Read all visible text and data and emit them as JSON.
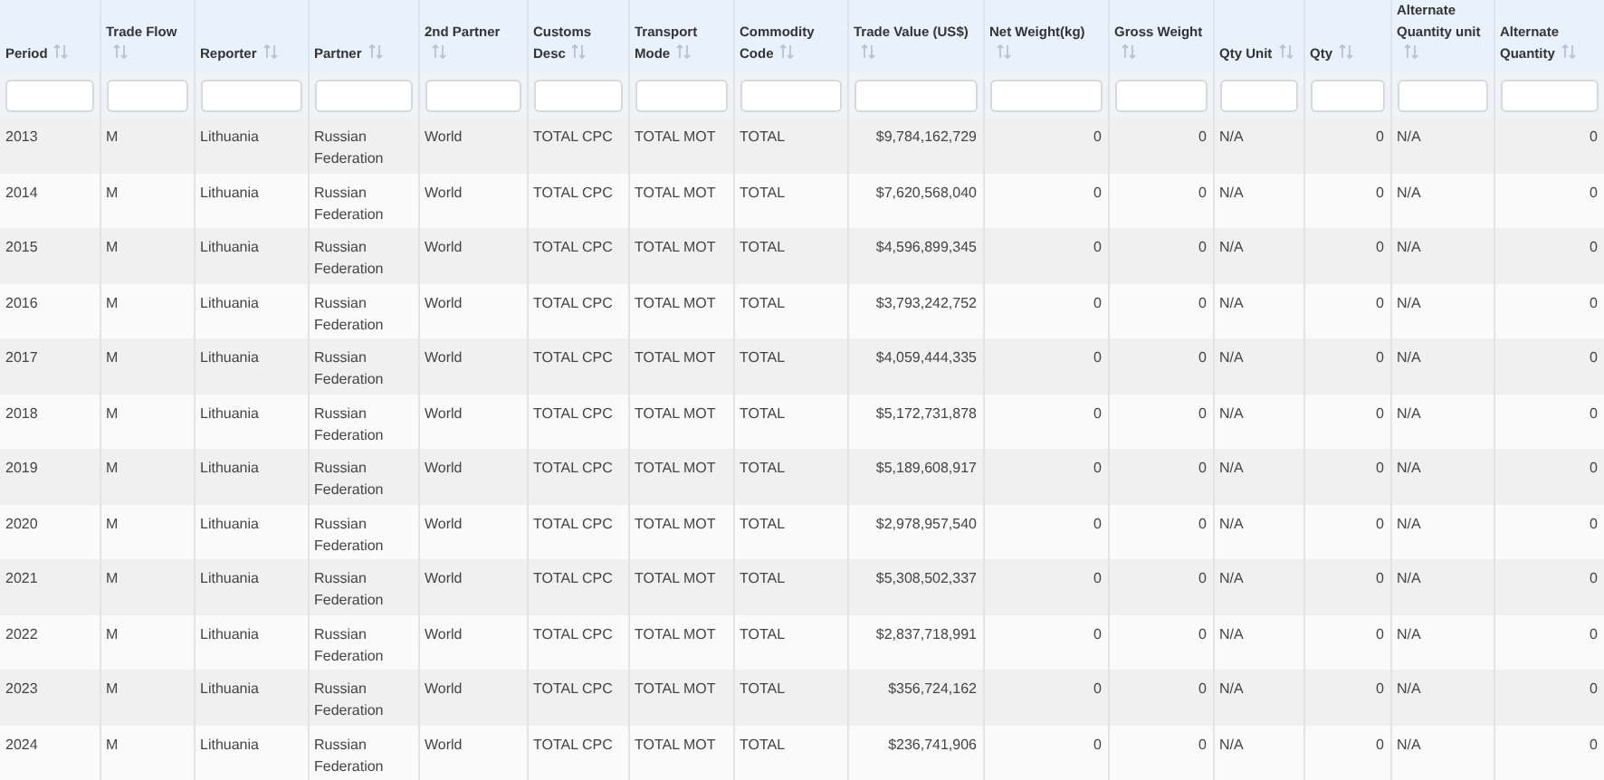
{
  "table": {
    "columns": [
      {
        "label": "Period",
        "kind": "text"
      },
      {
        "label": "Trade Flow",
        "kind": "text"
      },
      {
        "label": "Reporter",
        "kind": "text"
      },
      {
        "label": "Partner",
        "kind": "text"
      },
      {
        "label": "2nd Partner",
        "kind": "text"
      },
      {
        "label": "Customs Desc",
        "kind": "text"
      },
      {
        "label": "Transport Mode",
        "kind": "text"
      },
      {
        "label": "Commodity Code",
        "kind": "text"
      },
      {
        "label": "Trade Value (US$)",
        "kind": "number"
      },
      {
        "label": "Net Weight(kg)",
        "kind": "number"
      },
      {
        "label": "Gross Weight",
        "kind": "number"
      },
      {
        "label": "Qty Unit",
        "kind": "text"
      },
      {
        "label": "Qty",
        "kind": "number"
      },
      {
        "label": "Alternate Quantity unit",
        "kind": "text"
      },
      {
        "label": "Alternate Quantity",
        "kind": "number"
      }
    ],
    "rows": [
      [
        "2013",
        "M",
        "Lithuania",
        "Russian Federation",
        "World",
        "TOTAL CPC",
        "TOTAL MOT",
        "TOTAL",
        "$9,784,162,729",
        "0",
        "0",
        "N/A",
        "0",
        "N/A",
        "0"
      ],
      [
        "2014",
        "M",
        "Lithuania",
        "Russian Federation",
        "World",
        "TOTAL CPC",
        "TOTAL MOT",
        "TOTAL",
        "$7,620,568,040",
        "0",
        "0",
        "N/A",
        "0",
        "N/A",
        "0"
      ],
      [
        "2015",
        "M",
        "Lithuania",
        "Russian Federation",
        "World",
        "TOTAL CPC",
        "TOTAL MOT",
        "TOTAL",
        "$4,596,899,345",
        "0",
        "0",
        "N/A",
        "0",
        "N/A",
        "0"
      ],
      [
        "2016",
        "M",
        "Lithuania",
        "Russian Federation",
        "World",
        "TOTAL CPC",
        "TOTAL MOT",
        "TOTAL",
        "$3,793,242,752",
        "0",
        "0",
        "N/A",
        "0",
        "N/A",
        "0"
      ],
      [
        "2017",
        "M",
        "Lithuania",
        "Russian Federation",
        "World",
        "TOTAL CPC",
        "TOTAL MOT",
        "TOTAL",
        "$4,059,444,335",
        "0",
        "0",
        "N/A",
        "0",
        "N/A",
        "0"
      ],
      [
        "2018",
        "M",
        "Lithuania",
        "Russian Federation",
        "World",
        "TOTAL CPC",
        "TOTAL MOT",
        "TOTAL",
        "$5,172,731,878",
        "0",
        "0",
        "N/A",
        "0",
        "N/A",
        "0"
      ],
      [
        "2019",
        "M",
        "Lithuania",
        "Russian Federation",
        "World",
        "TOTAL CPC",
        "TOTAL MOT",
        "TOTAL",
        "$5,189,608,917",
        "0",
        "0",
        "N/A",
        "0",
        "N/A",
        "0"
      ],
      [
        "2020",
        "M",
        "Lithuania",
        "Russian Federation",
        "World",
        "TOTAL CPC",
        "TOTAL MOT",
        "TOTAL",
        "$2,978,957,540",
        "0",
        "0",
        "N/A",
        "0",
        "N/A",
        "0"
      ],
      [
        "2021",
        "M",
        "Lithuania",
        "Russian Federation",
        "World",
        "TOTAL CPC",
        "TOTAL MOT",
        "TOTAL",
        "$5,308,502,337",
        "0",
        "0",
        "N/A",
        "0",
        "N/A",
        "0"
      ],
      [
        "2022",
        "M",
        "Lithuania",
        "Russian Federation",
        "World",
        "TOTAL CPC",
        "TOTAL MOT",
        "TOTAL",
        "$2,837,718,991",
        "0",
        "0",
        "N/A",
        "0",
        "N/A",
        "0"
      ],
      [
        "2023",
        "M",
        "Lithuania",
        "Russian Federation",
        "World",
        "TOTAL CPC",
        "TOTAL MOT",
        "TOTAL",
        "$356,724,162",
        "0",
        "0",
        "N/A",
        "0",
        "N/A",
        "0"
      ],
      [
        "2024",
        "M",
        "Lithuania",
        "Russian Federation",
        "World",
        "TOTAL CPC",
        "TOTAL MOT",
        "TOTAL",
        "$236,741,906",
        "0",
        "0",
        "N/A",
        "0",
        "N/A",
        "0"
      ]
    ]
  }
}
